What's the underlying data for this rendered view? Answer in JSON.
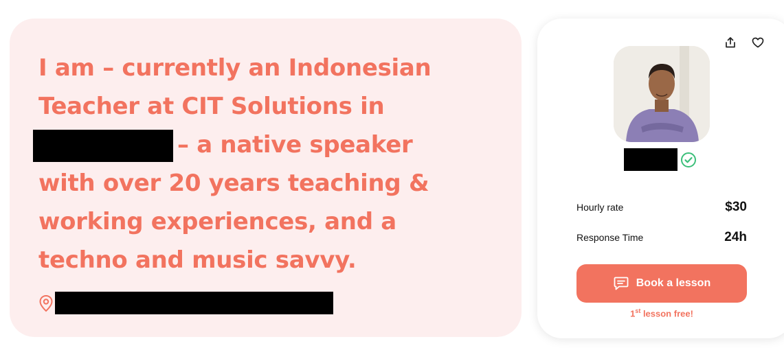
{
  "intro": {
    "line1": "I am – currently an Indonesian",
    "line2": "Teacher at CIT Solutions in",
    "line3_after": "– a native speaker",
    "line4": "with over 20 years teaching &",
    "line5": "working experiences, and a",
    "line6": "techno and music savvy."
  },
  "profile": {
    "hourly_rate_label": "Hourly rate",
    "hourly_rate_value": "$30",
    "response_time_label": "Response Time",
    "response_time_value": "24h",
    "book_button_label": "Book a lesson",
    "first_lesson_ordinal": "1",
    "first_lesson_suffix": "st",
    "first_lesson_text": " lesson free!"
  },
  "icons": {
    "share": "share-icon",
    "favorite": "heart-icon",
    "verified": "check-circle-icon",
    "location": "location-pin-icon",
    "chat": "chat-bubble-icon"
  },
  "colors": {
    "accent": "#f2735f",
    "intro_background": "#fdeeee",
    "verified": "#3cbf7a"
  }
}
